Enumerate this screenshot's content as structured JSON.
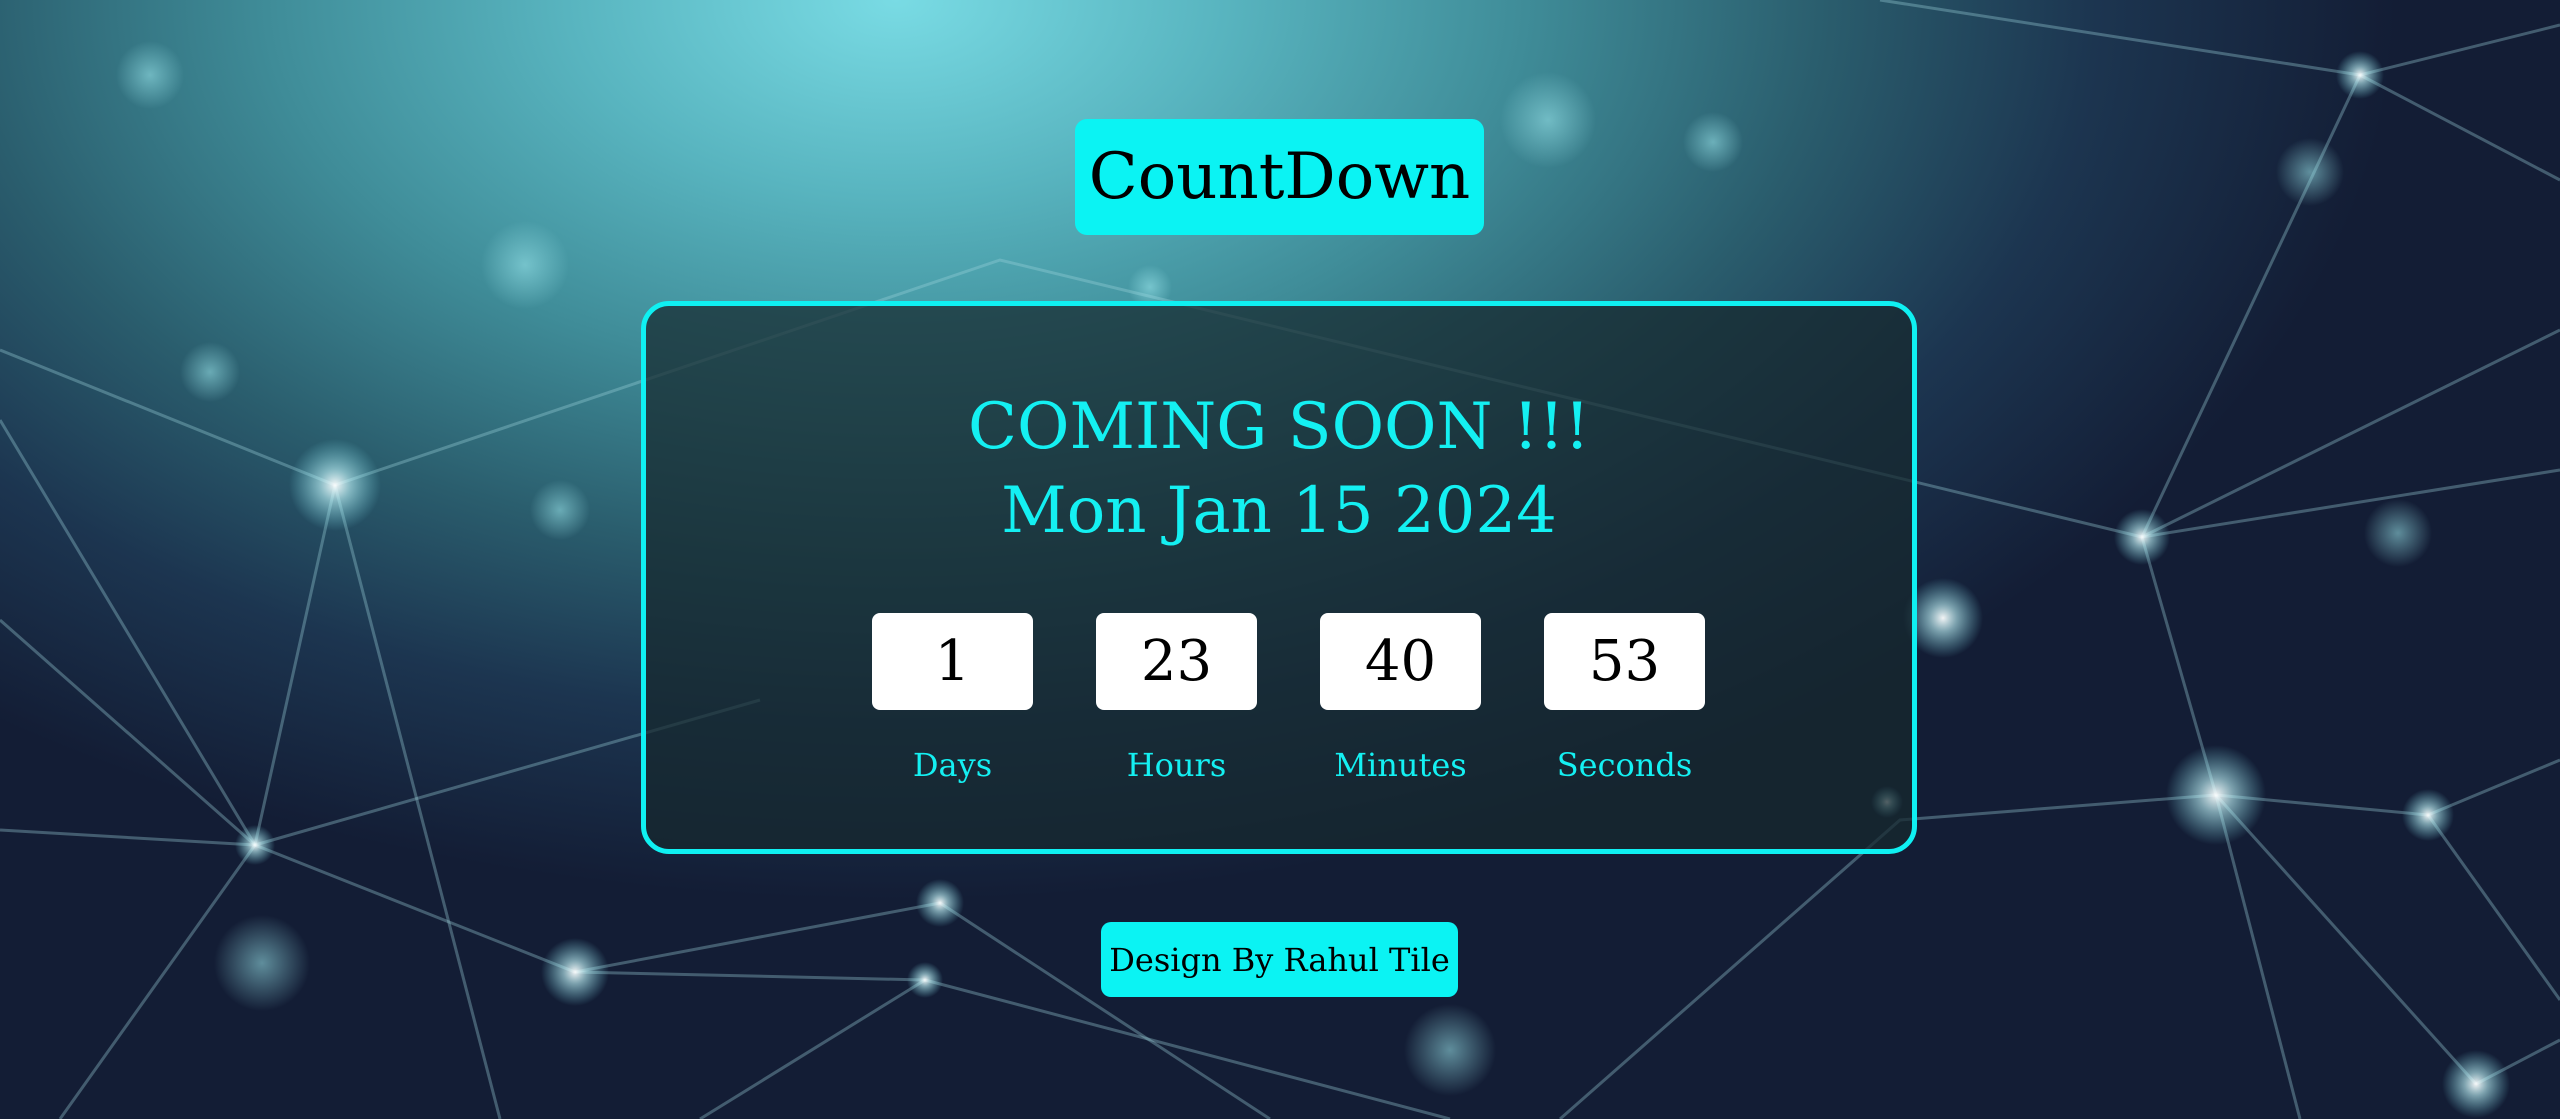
{
  "header": {
    "title": "CountDown"
  },
  "event": {
    "heading": "COMING SOON !!!",
    "date": "Mon Jan 15 2024"
  },
  "countdown": [
    {
      "value": "1",
      "label": "Days"
    },
    {
      "value": "23",
      "label": "Hours"
    },
    {
      "value": "40",
      "label": "Minutes"
    },
    {
      "value": "53",
      "label": "Seconds"
    }
  ],
  "footer": {
    "credit": "Design By Rahul Tile"
  },
  "colors": {
    "accent": "#0bf3f3",
    "accent_text": "#14f0f2",
    "tile_bg": "#ffffff"
  },
  "background": {
    "icon": "network-nodes-image"
  }
}
